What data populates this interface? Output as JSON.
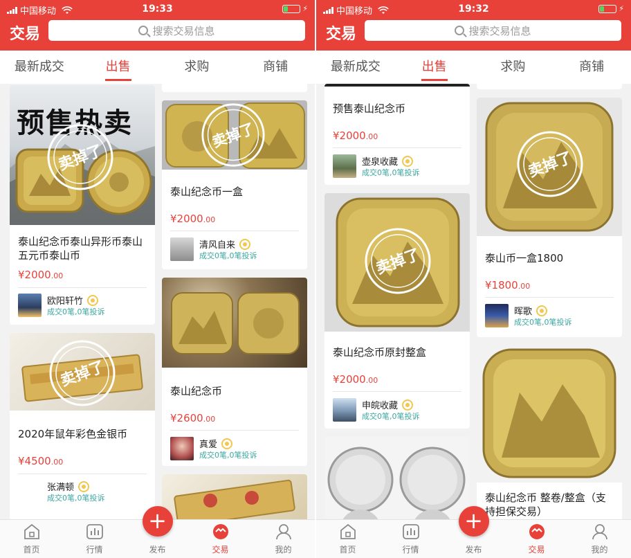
{
  "colors": {
    "accent": "#e8413a",
    "stats": "#3aa7a0",
    "badge": "#f3c64e"
  },
  "screens": [
    {
      "status": {
        "carrier": "中国移动",
        "time": "19:33"
      },
      "header": {
        "brand": "交易",
        "search_placeholder": "搜索交易信息"
      },
      "tabs": [
        {
          "label": "最新成交"
        },
        {
          "label": "出售"
        },
        {
          "label": "求购"
        },
        {
          "label": "商铺"
        }
      ],
      "overlay_texts": {
        "banner": "预售热卖",
        "stamp": "卖掉了"
      },
      "cards": [
        {
          "title": "泰山纪念币泰山异形币泰山五元币泰山币",
          "price": "¥2000",
          "price_cents": ".00",
          "seller": "欧阳轩竹",
          "stats": "成交0笔,0笔投诉"
        },
        {
          "title": "2020年鼠年彩色金银币",
          "price": "¥4500",
          "price_cents": ".00",
          "seller": "张满顿",
          "stats": "成交0笔,0笔投诉"
        },
        {
          "title": "泰山纪念币一盒",
          "price": "¥2000",
          "price_cents": ".00",
          "seller": "清风自来",
          "stats": "成交0笔,0笔投诉"
        },
        {
          "title": "泰山纪念币",
          "price": "¥2600",
          "price_cents": ".00",
          "seller": "真爱",
          "stats": "成交0笔,0笔投诉"
        }
      ],
      "nav": [
        {
          "label": "首页",
          "icon": "home-icon"
        },
        {
          "label": "行情",
          "icon": "chart-icon"
        },
        {
          "label": "发布",
          "icon": "plus-icon"
        },
        {
          "label": "交易",
          "icon": "trade-icon"
        },
        {
          "label": "我的",
          "icon": "user-icon"
        }
      ]
    },
    {
      "status": {
        "carrier": "中国移动",
        "time": "19:32"
      },
      "header": {
        "brand": "交易",
        "search_placeholder": "搜索交易信息"
      },
      "tabs": [
        {
          "label": "最新成交"
        },
        {
          "label": "出售"
        },
        {
          "label": "求购"
        },
        {
          "label": "商铺"
        }
      ],
      "overlay_texts": {
        "stamp": "卖掉了"
      },
      "cards": [
        {
          "title": "预售泰山纪念币",
          "price": "¥2000",
          "price_cents": ".00",
          "seller": "壶泉收藏",
          "stats": "成交0笔,0笔投诉"
        },
        {
          "title": "泰山纪念币原封整盒",
          "price": "¥2000",
          "price_cents": ".00",
          "seller": "申皖收藏",
          "stats": "成交0笔,0笔投诉"
        },
        {
          "title": "泰山币一盒1800",
          "price": "¥1800",
          "price_cents": ".00",
          "seller": "晖歌",
          "stats": "成交0笔,0笔投诉"
        },
        {
          "title": "泰山纪念币 整卷/整盒（支持担保交易）"
        }
      ],
      "nav": [
        {
          "label": "首页",
          "icon": "home-icon"
        },
        {
          "label": "行情",
          "icon": "chart-icon"
        },
        {
          "label": "发布",
          "icon": "plus-icon"
        },
        {
          "label": "交易",
          "icon": "trade-icon"
        },
        {
          "label": "我的",
          "icon": "user-icon"
        }
      ]
    }
  ]
}
